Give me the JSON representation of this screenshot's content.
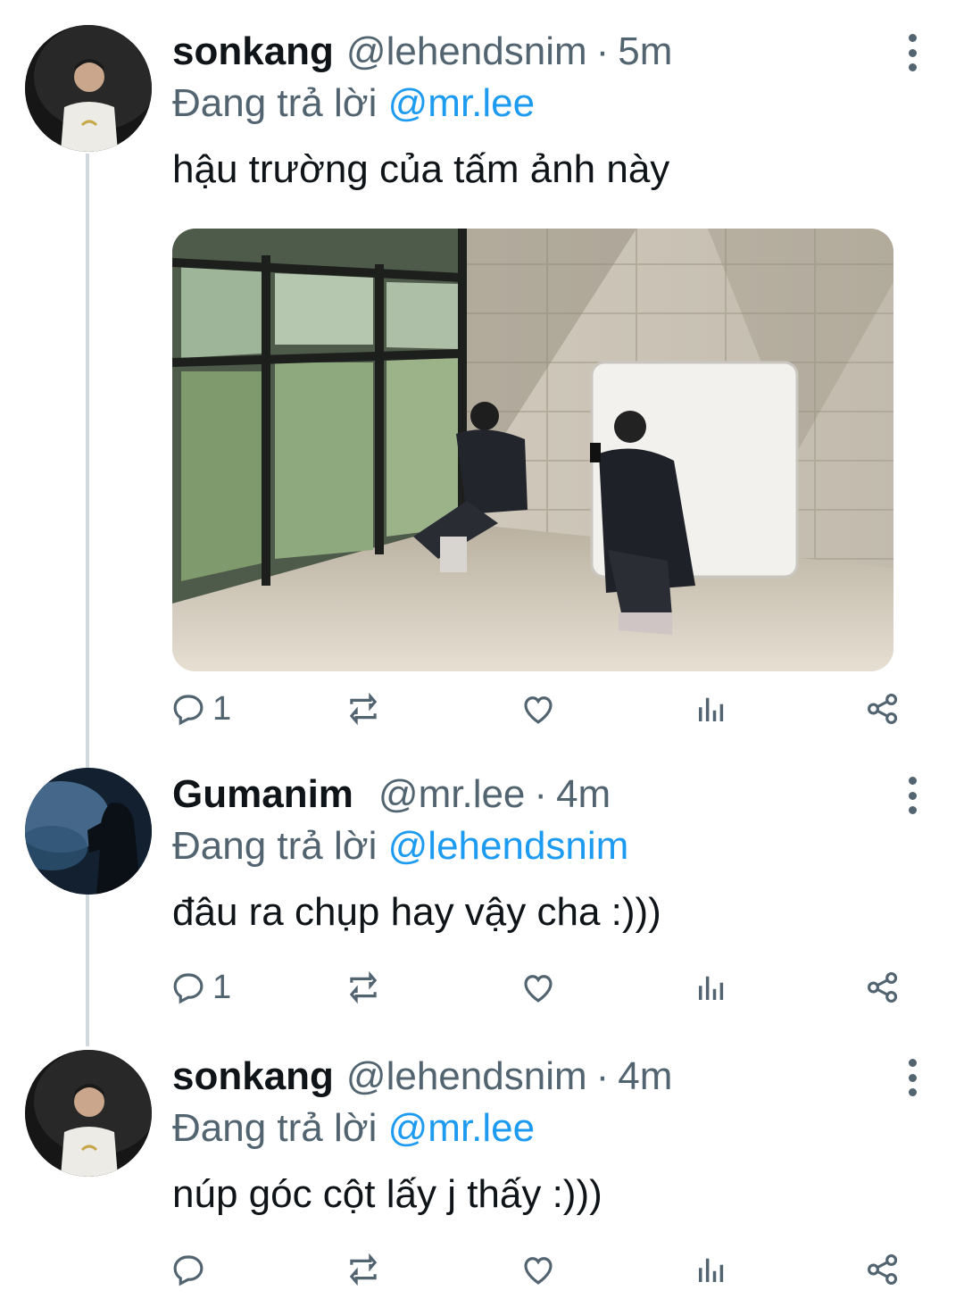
{
  "tweets": [
    {
      "name": "sonkang",
      "handle": "@lehendsnim",
      "separator": "·",
      "time": "5m",
      "replying_prefix": "Đang trả lời",
      "replying_to": "@mr.lee",
      "text": "hậu trường của tấm ảnh này",
      "reply_count": "1",
      "has_media": true
    },
    {
      "name": "Gumanim",
      "handle": "@mr.lee",
      "separator": "·",
      "time": "4m",
      "replying_prefix": "Đang trả lời",
      "replying_to": "@lehendsnim",
      "text": "đâu ra chụp hay vậy cha :)))",
      "reply_count": "1",
      "has_media": false
    },
    {
      "name": "sonkang",
      "handle": "@lehendsnim",
      "separator": "·",
      "time": "4m",
      "replying_prefix": "Đang trả lời",
      "replying_to": "@mr.lee",
      "text": "núp góc cột lấy j thấy :)))",
      "reply_count": "",
      "has_media": false
    }
  ],
  "icons": {
    "reply": "reply-icon",
    "retweet": "retweet-icon",
    "like": "like-icon",
    "analytics": "analytics-icon",
    "share": "share-icon",
    "more": "more-icon"
  },
  "colors": {
    "text": "#0f1419",
    "secondary": "#536471",
    "mention": "#1d9bf0",
    "thread_line": "#cfd9de"
  }
}
